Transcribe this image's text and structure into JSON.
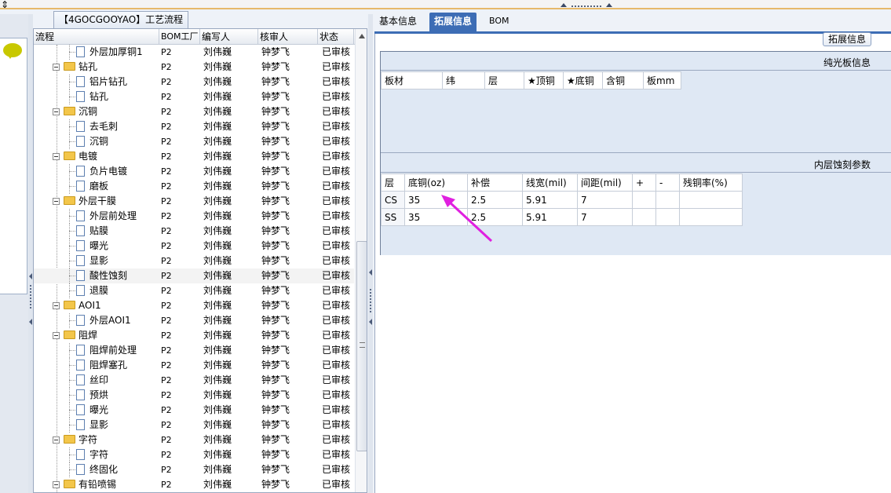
{
  "window": {
    "move_glyph": "⇕"
  },
  "left_panel": {
    "title": "【4GOCGOOYAO】工艺流程",
    "columns": [
      "流程",
      "BOM工厂",
      "编写人",
      "核审人",
      "状态"
    ],
    "rows": [
      {
        "name": "外层加厚铜1",
        "type": "doc",
        "level": 2,
        "bom": "P2",
        "writer": "刘伟巍",
        "reviewer": "钟梦飞",
        "status": "已审核"
      },
      {
        "name": "钻孔",
        "type": "folder",
        "level": 1,
        "bom": "P2",
        "writer": "刘伟巍",
        "reviewer": "钟梦飞",
        "status": "已审核"
      },
      {
        "name": "铝片钻孔",
        "type": "doc",
        "level": 2,
        "bom": "P2",
        "writer": "刘伟巍",
        "reviewer": "钟梦飞",
        "status": "已审核"
      },
      {
        "name": "钻孔",
        "type": "doc",
        "level": 2,
        "bom": "P2",
        "writer": "刘伟巍",
        "reviewer": "钟梦飞",
        "status": "已审核"
      },
      {
        "name": "沉铜",
        "type": "folder",
        "level": 1,
        "bom": "P2",
        "writer": "刘伟巍",
        "reviewer": "钟梦飞",
        "status": "已审核"
      },
      {
        "name": "去毛刺",
        "type": "doc",
        "level": 2,
        "bom": "P2",
        "writer": "刘伟巍",
        "reviewer": "钟梦飞",
        "status": "已审核"
      },
      {
        "name": "沉铜",
        "type": "doc",
        "level": 2,
        "bom": "P2",
        "writer": "刘伟巍",
        "reviewer": "钟梦飞",
        "status": "已审核"
      },
      {
        "name": "电镀",
        "type": "folder",
        "level": 1,
        "bom": "P2",
        "writer": "刘伟巍",
        "reviewer": "钟梦飞",
        "status": "已审核"
      },
      {
        "name": "负片电镀",
        "type": "doc",
        "level": 2,
        "bom": "P2",
        "writer": "刘伟巍",
        "reviewer": "钟梦飞",
        "status": "已审核"
      },
      {
        "name": "磨板",
        "type": "doc",
        "level": 2,
        "bom": "P2",
        "writer": "刘伟巍",
        "reviewer": "钟梦飞",
        "status": "已审核"
      },
      {
        "name": "外层干膜",
        "type": "folder",
        "level": 1,
        "bom": "P2",
        "writer": "刘伟巍",
        "reviewer": "钟梦飞",
        "status": "已审核"
      },
      {
        "name": "外层前处理",
        "type": "doc",
        "level": 2,
        "bom": "P2",
        "writer": "刘伟巍",
        "reviewer": "钟梦飞",
        "status": "已审核"
      },
      {
        "name": "贴膜",
        "type": "doc",
        "level": 2,
        "bom": "P2",
        "writer": "刘伟巍",
        "reviewer": "钟梦飞",
        "status": "已审核"
      },
      {
        "name": "曝光",
        "type": "doc",
        "level": 2,
        "bom": "P2",
        "writer": "刘伟巍",
        "reviewer": "钟梦飞",
        "status": "已审核"
      },
      {
        "name": "显影",
        "type": "doc",
        "level": 2,
        "bom": "P2",
        "writer": "刘伟巍",
        "reviewer": "钟梦飞",
        "status": "已审核"
      },
      {
        "name": "酸性蚀刻",
        "type": "doc",
        "level": 2,
        "bom": "P2",
        "writer": "刘伟巍",
        "reviewer": "钟梦飞",
        "status": "已审核",
        "selected": true
      },
      {
        "name": "退膜",
        "type": "doc",
        "level": 2,
        "bom": "P2",
        "writer": "刘伟巍",
        "reviewer": "钟梦飞",
        "status": "已审核"
      },
      {
        "name": "AOI1",
        "type": "folder",
        "level": 1,
        "bom": "P2",
        "writer": "刘伟巍",
        "reviewer": "钟梦飞",
        "status": "已审核"
      },
      {
        "name": "外层AOI1",
        "type": "doc",
        "level": 2,
        "bom": "P2",
        "writer": "刘伟巍",
        "reviewer": "钟梦飞",
        "status": "已审核"
      },
      {
        "name": "阻焊",
        "type": "folder",
        "level": 1,
        "bom": "P2",
        "writer": "刘伟巍",
        "reviewer": "钟梦飞",
        "status": "已审核"
      },
      {
        "name": "阻焊前处理",
        "type": "doc",
        "level": 2,
        "bom": "P2",
        "writer": "刘伟巍",
        "reviewer": "钟梦飞",
        "status": "已审核"
      },
      {
        "name": "阻焊塞孔",
        "type": "doc",
        "level": 2,
        "bom": "P2",
        "writer": "刘伟巍",
        "reviewer": "钟梦飞",
        "status": "已审核"
      },
      {
        "name": "丝印",
        "type": "doc",
        "level": 2,
        "bom": "P2",
        "writer": "刘伟巍",
        "reviewer": "钟梦飞",
        "status": "已审核"
      },
      {
        "name": "预烘",
        "type": "doc",
        "level": 2,
        "bom": "P2",
        "writer": "刘伟巍",
        "reviewer": "钟梦飞",
        "status": "已审核"
      },
      {
        "name": "曝光",
        "type": "doc",
        "level": 2,
        "bom": "P2",
        "writer": "刘伟巍",
        "reviewer": "钟梦飞",
        "status": "已审核"
      },
      {
        "name": "显影",
        "type": "doc",
        "level": 2,
        "bom": "P2",
        "writer": "刘伟巍",
        "reviewer": "钟梦飞",
        "status": "已审核"
      },
      {
        "name": "字符",
        "type": "folder",
        "level": 1,
        "bom": "P2",
        "writer": "刘伟巍",
        "reviewer": "钟梦飞",
        "status": "已审核"
      },
      {
        "name": "字符",
        "type": "doc",
        "level": 2,
        "bom": "P2",
        "writer": "刘伟巍",
        "reviewer": "钟梦飞",
        "status": "已审核"
      },
      {
        "name": "终固化",
        "type": "doc",
        "level": 2,
        "bom": "P2",
        "writer": "刘伟巍",
        "reviewer": "钟梦飞",
        "status": "已审核"
      },
      {
        "name": "有铅喷锡",
        "type": "folder",
        "level": 1,
        "bom": "P2",
        "writer": "刘伟巍",
        "reviewer": "钟梦飞",
        "status": "已审核"
      }
    ]
  },
  "right_panel": {
    "tabs": [
      {
        "label": "基本信息",
        "active": false
      },
      {
        "label": "拓展信息",
        "active": true
      },
      {
        "label": "BOM",
        "active": false
      }
    ],
    "ext_button": "拓展信息",
    "section1": {
      "title": "纯光板信息",
      "columns": [
        "板材",
        "纬",
        "层",
        "★顶铜",
        "★底铜",
        "含铜",
        "板mm"
      ]
    },
    "section2": {
      "title": "内层蚀刻参数",
      "columns": [
        "层",
        "底铜(oz)",
        "补偿",
        "线宽(mil)",
        "间距(mil)",
        "+",
        "-",
        "残铜率(%)"
      ],
      "rows": [
        [
          "CS",
          "35",
          "2.5",
          "5.91",
          "7",
          "",
          "",
          ""
        ],
        [
          "SS",
          "35",
          "2.5",
          "5.91",
          "7",
          "",
          "",
          ""
        ]
      ]
    }
  },
  "colors": {
    "accent": "#3d6db5",
    "annotation_arrow": "#e020e0",
    "highlight_corner": "#f6d79e",
    "folder": "#f3c64a"
  }
}
